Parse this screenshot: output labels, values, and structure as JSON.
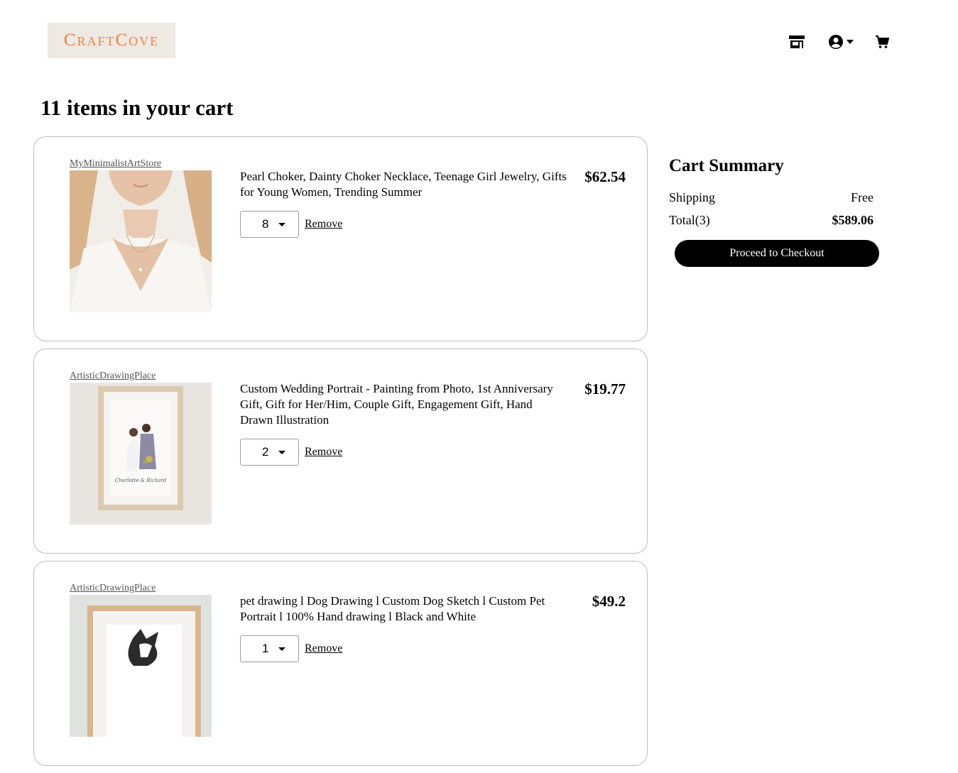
{
  "header": {
    "logo_text": "CraftCove",
    "icons": [
      "store-icon",
      "user-circle-icon",
      "caret-down-icon",
      "cart-icon"
    ]
  },
  "cart": {
    "title": "11 items in your cart",
    "items": [
      {
        "shop": "MyMinimalistArtStore",
        "title": "Pearl Choker, Dainty Choker Necklace, Teenage Girl Jewelry, Gifts for Young Women, Trending Summer",
        "price": "$62.54",
        "quantity": "8",
        "remove_label": "Remove"
      },
      {
        "shop": "ArtisticDrawingPlace",
        "title": "Custom Wedding Portrait - Painting from Photo, 1st Anniversary Gift, Gift for Her/Him, Couple Gift, Engagement Gift, Hand Drawn Illustration",
        "price": "$19.77",
        "quantity": "2",
        "remove_label": "Remove"
      },
      {
        "shop": "ArtisticDrawingPlace",
        "title": "pet drawing l Dog Drawing l Custom Dog Sketch l Custom Pet Portrait l 100% Hand drawing l Black and White",
        "price": "$49.2",
        "quantity": "1",
        "remove_label": "Remove"
      }
    ]
  },
  "summary": {
    "title": "Cart Summary",
    "shipping_label": "Shipping",
    "shipping_value": "Free",
    "total_label": "Total(3)",
    "total_value": "$589.06",
    "checkout_label": "Proceed to Checkout"
  }
}
